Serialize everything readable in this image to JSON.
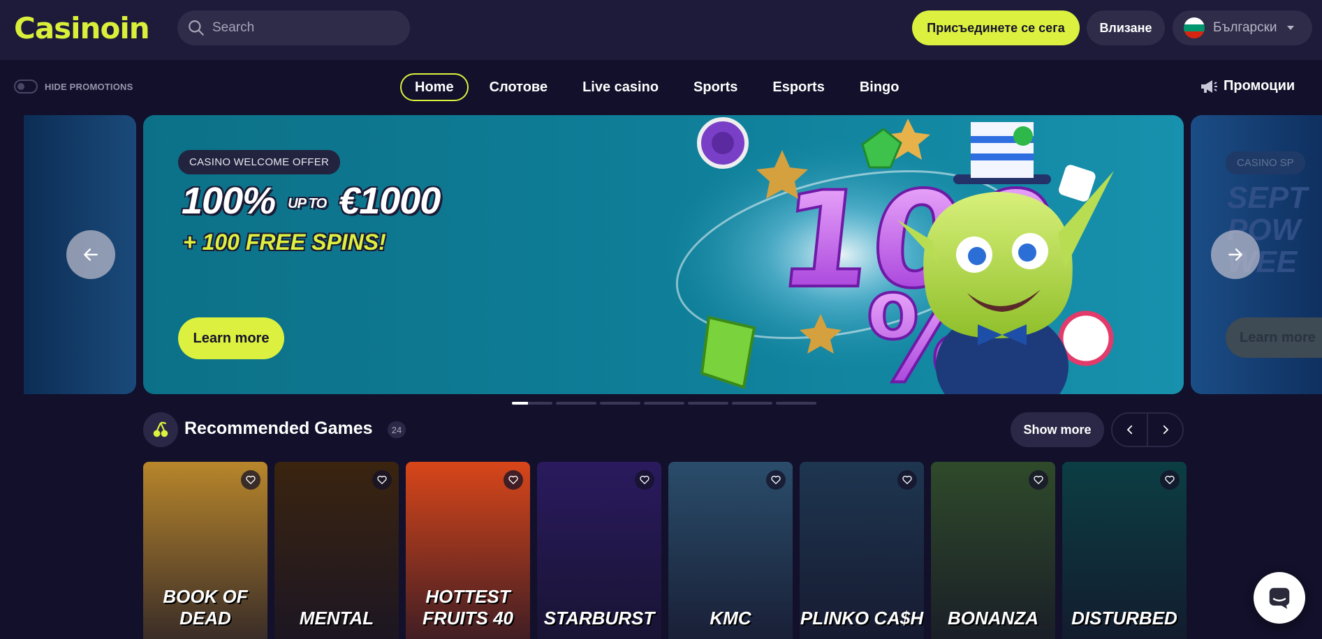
{
  "header": {
    "logo": "Casinoin",
    "search_placeholder": "Search",
    "join_label": "Присъединете се сега",
    "login_label": "Влизане",
    "language_label": "Български",
    "flag_colors": [
      "#ffffff",
      "#00966e",
      "#d62612"
    ]
  },
  "nav": {
    "hide_promotions_label": "HIDE PROMOTIONS",
    "items": [
      {
        "label": "Home",
        "active": true
      },
      {
        "label": "Слотове"
      },
      {
        "label": "Live casino"
      },
      {
        "label": "Sports"
      },
      {
        "label": "Esports"
      },
      {
        "label": "Bingo"
      }
    ],
    "promotions_label": "Промоции"
  },
  "carousel": {
    "badge": "CASINO WELCOME OFFER",
    "headline_main": "100%",
    "headline_upto": "UP TO",
    "headline_amount": "€1000",
    "subline": "+ 100 FREE SPINS!",
    "cta": "Learn more",
    "next_slide_badge": "CASINO SP",
    "next_slide_text": "SEPT POW WEE",
    "next_slide_cta": "Learn more",
    "slide_count": 7,
    "active_slide": 1,
    "active_progress": 0.4
  },
  "recommended": {
    "title": "Recommended Games",
    "count": "24",
    "show_more": "Show more",
    "games": [
      {
        "title": "BOOK OF DEAD",
        "bg": "#b8862b"
      },
      {
        "title": "MENTAL",
        "bg": "#3a2410"
      },
      {
        "title": "HOTTEST FRUITS 40",
        "bg": "#d8461a"
      },
      {
        "title": "STARBURST",
        "bg": "#2a1a5e"
      },
      {
        "title": "KMC",
        "bg": "#2a4d6b"
      },
      {
        "title": "PLINKO CA$H",
        "bg": "#1e3650"
      },
      {
        "title": "BONANZA",
        "bg": "#2f4a2a"
      },
      {
        "title": "DISTURBED",
        "bg": "#0c3e44"
      }
    ]
  },
  "colors": {
    "accent": "#dcf13f",
    "background": "#12102a",
    "header": "#1d1a3a"
  }
}
